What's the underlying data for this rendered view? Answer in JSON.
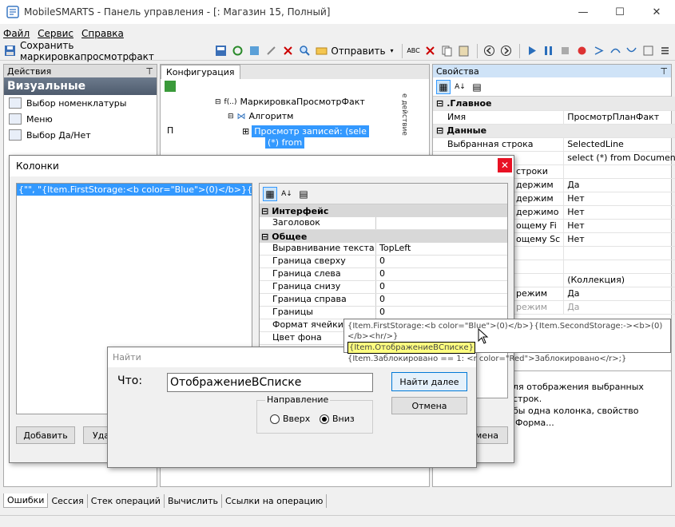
{
  "window": {
    "title": "MobileSMARTS - Панель управления - [: Магазин 15, Полный]",
    "minimize": "—",
    "maximize": "☐",
    "close": "✕"
  },
  "menu": [
    "Файл",
    "Сервис",
    "Справка"
  ],
  "toolbar": {
    "save_label": "Сохранить маркировкапросмотрфакт",
    "send_label": "Отправить"
  },
  "left_panel": {
    "header": "Действия",
    "pin": "⊤",
    "section": "Визуальные",
    "items": [
      "Выбор номенклатуры",
      "Меню",
      "Выбор Да/Нет"
    ]
  },
  "center_panel": {
    "tab": "Конфигурация",
    "letter": "П",
    "node1": "МаркировкаПросмотрФакт",
    "node2": "Алгоритм",
    "node3_line1": "Просмотр записей: (sele",
    "node3_line2": "(*) from",
    "side_label": "е действие"
  },
  "right_panel": {
    "header": "Свойства",
    "categories": {
      "main": ".Главное",
      "data": "Данные"
    },
    "rows_main": [
      {
        "name": "Имя",
        "value": "ПросмотрПланФакт"
      }
    ],
    "rows_data": [
      {
        "name": "Выбранная строка",
        "value": "SelectedLine"
      },
      {
        "name": "",
        "value": "select (*) from Document.Cu"
      },
      {
        "name": "строки",
        "value": ""
      },
      {
        "name": "держим",
        "value": "Да"
      },
      {
        "name": "держим",
        "value": "Нет"
      },
      {
        "name": "держимо",
        "value": "Нет"
      },
      {
        "name": "ощему Fi",
        "value": "Нет"
      },
      {
        "name": "ощему Sc",
        "value": "Нет"
      },
      {
        "name": "",
        "value": ""
      },
      {
        "name": "",
        "value": ""
      },
      {
        "name": "",
        "value": "(Коллекция)"
      },
      {
        "name": "режим",
        "value": "Да"
      },
      {
        "name": "режим",
        "value": "Да"
      }
    ],
    "desc_line1": "ля отображения выбранных строк.",
    "desc_line2": "бы одна колонка, свойство 'Форма..."
  },
  "columns_dialog": {
    "title": "Колонки",
    "list_item": "{\"\", \"{Item.FirstStorage:<b color=\"Blue\">(0)</b>}{Item.SecondStorage",
    "cat_interface": "Интерфейс",
    "cat_general": "Общее",
    "props": [
      {
        "label": "Заголовок",
        "value": ""
      },
      {
        "label": "Выравнивание текста",
        "value": "TopLeft"
      },
      {
        "label": "Граница сверху",
        "value": "0"
      },
      {
        "label": "Граница слева",
        "value": "0"
      },
      {
        "label": "Граница снизу",
        "value": "0"
      },
      {
        "label": "Граница справа",
        "value": "0"
      },
      {
        "label": "Границы",
        "value": "0"
      },
      {
        "label": "Формат ячейки",
        "value": ""
      },
      {
        "label": "Цвет фона",
        "value": ""
      }
    ],
    "add_button": "Добавить",
    "delete_button_partial": "Уда",
    "cancel_button_partial": "мена"
  },
  "tooltip": {
    "line1": "{Item.FirstStorage:<b color=\"Blue\">(0)</b>}{Item.SecondStorage:-><b>(0)</b><hr/>}",
    "line2": "{Item.ОтображениеВСписке}",
    "line3": "{Item.Заблокировано == 1: <r color=\"Red\">Заблокировано</r>;}"
  },
  "find_dialog": {
    "title": "Найти",
    "what_label": "Что:",
    "query": "ОтображениеВСписке",
    "direction_label": "Направление",
    "up": "Вверх",
    "down": "Вниз",
    "find_next": "Найти далее",
    "cancel": "Отмена"
  },
  "bottom_tabs": [
    "Ошибки",
    "Сессия",
    "Стек операций",
    "Вычислить",
    "Ссылки на операцию"
  ]
}
